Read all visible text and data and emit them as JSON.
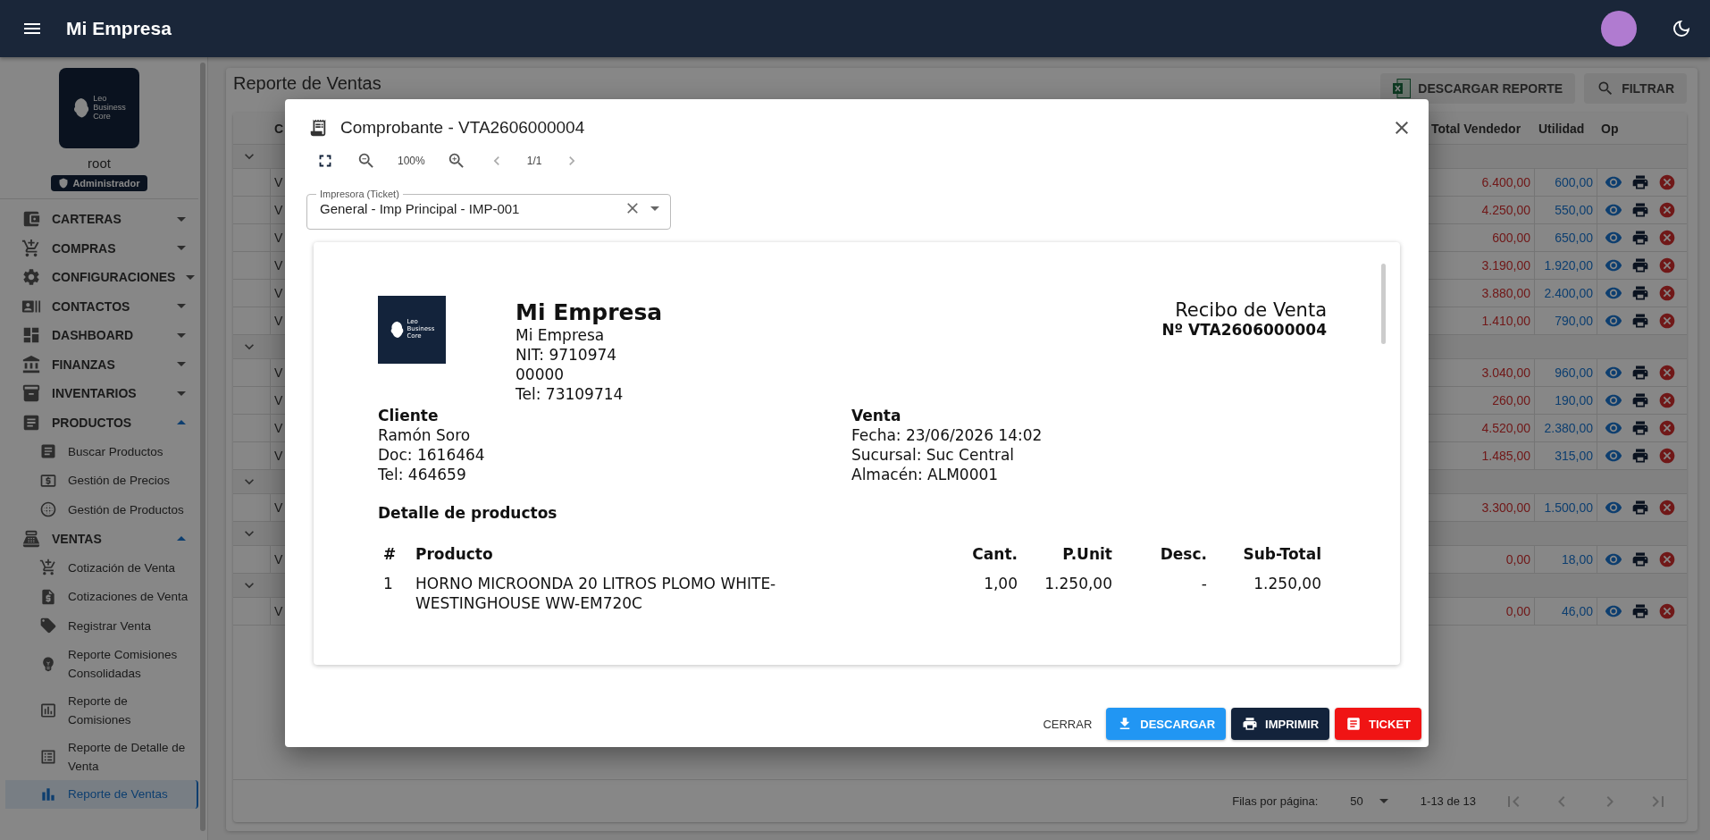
{
  "app_bar": {
    "title": "Mi Empresa"
  },
  "sidebar": {
    "logo_lines": [
      "Leo",
      "Business",
      "Core"
    ],
    "user_name": "root",
    "role": "Administrador",
    "menu": [
      {
        "label": "CARTERAS",
        "expanded": false
      },
      {
        "label": "COMPRAS",
        "expanded": false
      },
      {
        "label": "CONFIGURACIONES",
        "expanded": false
      },
      {
        "label": "CONTACTOS",
        "expanded": false
      },
      {
        "label": "DASHBOARD",
        "expanded": false
      },
      {
        "label": "FINANZAS",
        "expanded": false
      },
      {
        "label": "INVENTARIOS",
        "expanded": false
      },
      {
        "label": "PRODUCTOS",
        "expanded": true,
        "children": [
          {
            "label": "Buscar Productos",
            "selected": false
          },
          {
            "label": "Gestión de Precios",
            "selected": false
          },
          {
            "label": "Gestión de Productos",
            "selected": false
          }
        ]
      },
      {
        "label": "VENTAS",
        "expanded": true,
        "children": [
          {
            "label": "Cotización de Venta",
            "selected": false
          },
          {
            "label": "Cotizaciones de Venta",
            "selected": false
          },
          {
            "label": "Registrar Venta",
            "selected": false
          },
          {
            "label": "Reporte Comisiones Consolidadas",
            "selected": false
          },
          {
            "label": "Reporte de Comisiones",
            "selected": false
          },
          {
            "label": "Reporte de Detalle de Venta",
            "selected": false
          },
          {
            "label": "Reporte de Ventas",
            "selected": true
          }
        ]
      }
    ]
  },
  "page": {
    "title": "Reporte de Ventas",
    "buttons": [
      "DESCARGAR REPORTE",
      "FILTRAR"
    ],
    "table": {
      "column_2": "C",
      "columns": [
        "Total Vendedor",
        "Utilidad",
        "Op"
      ],
      "rows": [
        {
          "kind": "group",
          "expanded": true
        },
        {
          "kind": "sale",
          "column_2": "V",
          "total_vendedor": "6.400,00",
          "utilidad": "600,00"
        },
        {
          "kind": "sale",
          "column_2": "V",
          "total_vendedor": "4.250,00",
          "utilidad": "550,00"
        },
        {
          "kind": "sale",
          "column_2": "V",
          "total_vendedor": "600,00",
          "utilidad": "650,00"
        },
        {
          "kind": "sale",
          "column_2": "V",
          "total_vendedor": "3.190,00",
          "utilidad": "1.920,00"
        },
        {
          "kind": "sale",
          "column_2": "V",
          "total_vendedor": "3.880,00",
          "utilidad": "2.400,00"
        },
        {
          "kind": "sale",
          "column_2": "V",
          "total_vendedor": "1.410,00",
          "utilidad": "790,00"
        },
        {
          "kind": "group",
          "expanded": true
        },
        {
          "kind": "sale",
          "column_2": "V",
          "total_vendedor": "3.040,00",
          "utilidad": "960,00"
        },
        {
          "kind": "sale",
          "column_2": "V",
          "total_vendedor": "260,00",
          "utilidad": "190,00"
        },
        {
          "kind": "sale",
          "column_2": "V",
          "total_vendedor": "4.520,00",
          "utilidad": "2.380,00"
        },
        {
          "kind": "sale",
          "column_2": "V",
          "total_vendedor": "1.485,00",
          "utilidad": "315,00"
        },
        {
          "kind": "group",
          "expanded": true
        },
        {
          "kind": "sale",
          "column_2": "V",
          "total_vendedor": "3.300,00",
          "utilidad": "1.500,00"
        },
        {
          "kind": "group",
          "expanded": true
        },
        {
          "kind": "sale",
          "column_2": "V",
          "total_vendedor": "0,00",
          "utilidad": "18,00"
        },
        {
          "kind": "group",
          "expanded": true
        },
        {
          "kind": "sale",
          "column_2": "V",
          "total_vendedor": "0,00",
          "utilidad": "46,00"
        }
      ]
    },
    "pagination": {
      "rows_per_page_label": "Filas por página:",
      "rows_per_page": "50",
      "range": "1-13 de 13"
    }
  },
  "dialog": {
    "title": "Comprobante - VTA2606000004",
    "zoom": "100%",
    "page": "1/1",
    "printer_field": {
      "label": "Impresora (Ticket)",
      "value": "General - Imp Principal - IMP-001"
    },
    "receipt": {
      "logo_lines": [
        "Leo",
        "Business",
        "Core"
      ],
      "company_name": "Mi Empresa",
      "company_lines": [
        "Mi Empresa",
        "NIT: 9710974",
        "00000",
        "Tel: 73109714"
      ],
      "doc_title": "Recibo de Venta",
      "doc_number": "Nº VTA2606000004",
      "client": {
        "heading": "Cliente",
        "lines": [
          "Ramón Soro",
          "Doc: 1616464",
          "Tel: 464659"
        ]
      },
      "sale": {
        "heading": "Venta",
        "lines": [
          "Fecha: 23/06/2026 14:02",
          "Sucursal: Suc Central",
          "Almacén: ALM0001"
        ]
      },
      "details_heading": "Detalle de productos",
      "columns": [
        "#",
        "Producto",
        "Cant.",
        "P.Unit",
        "Desc.",
        "Sub-Total"
      ],
      "items": [
        [
          "1",
          "HORNO MICROONDA 20 LITROS PLOMO WHITE-WESTINGHOUSE WW-EM720C",
          "1,00",
          "1.250,00",
          "-",
          "1.250,00"
        ]
      ]
    },
    "buttons": {
      "close": "CERRAR",
      "download": "DESCARGAR",
      "print": "IMPRIMIR",
      "ticket": "TICKET"
    }
  }
}
